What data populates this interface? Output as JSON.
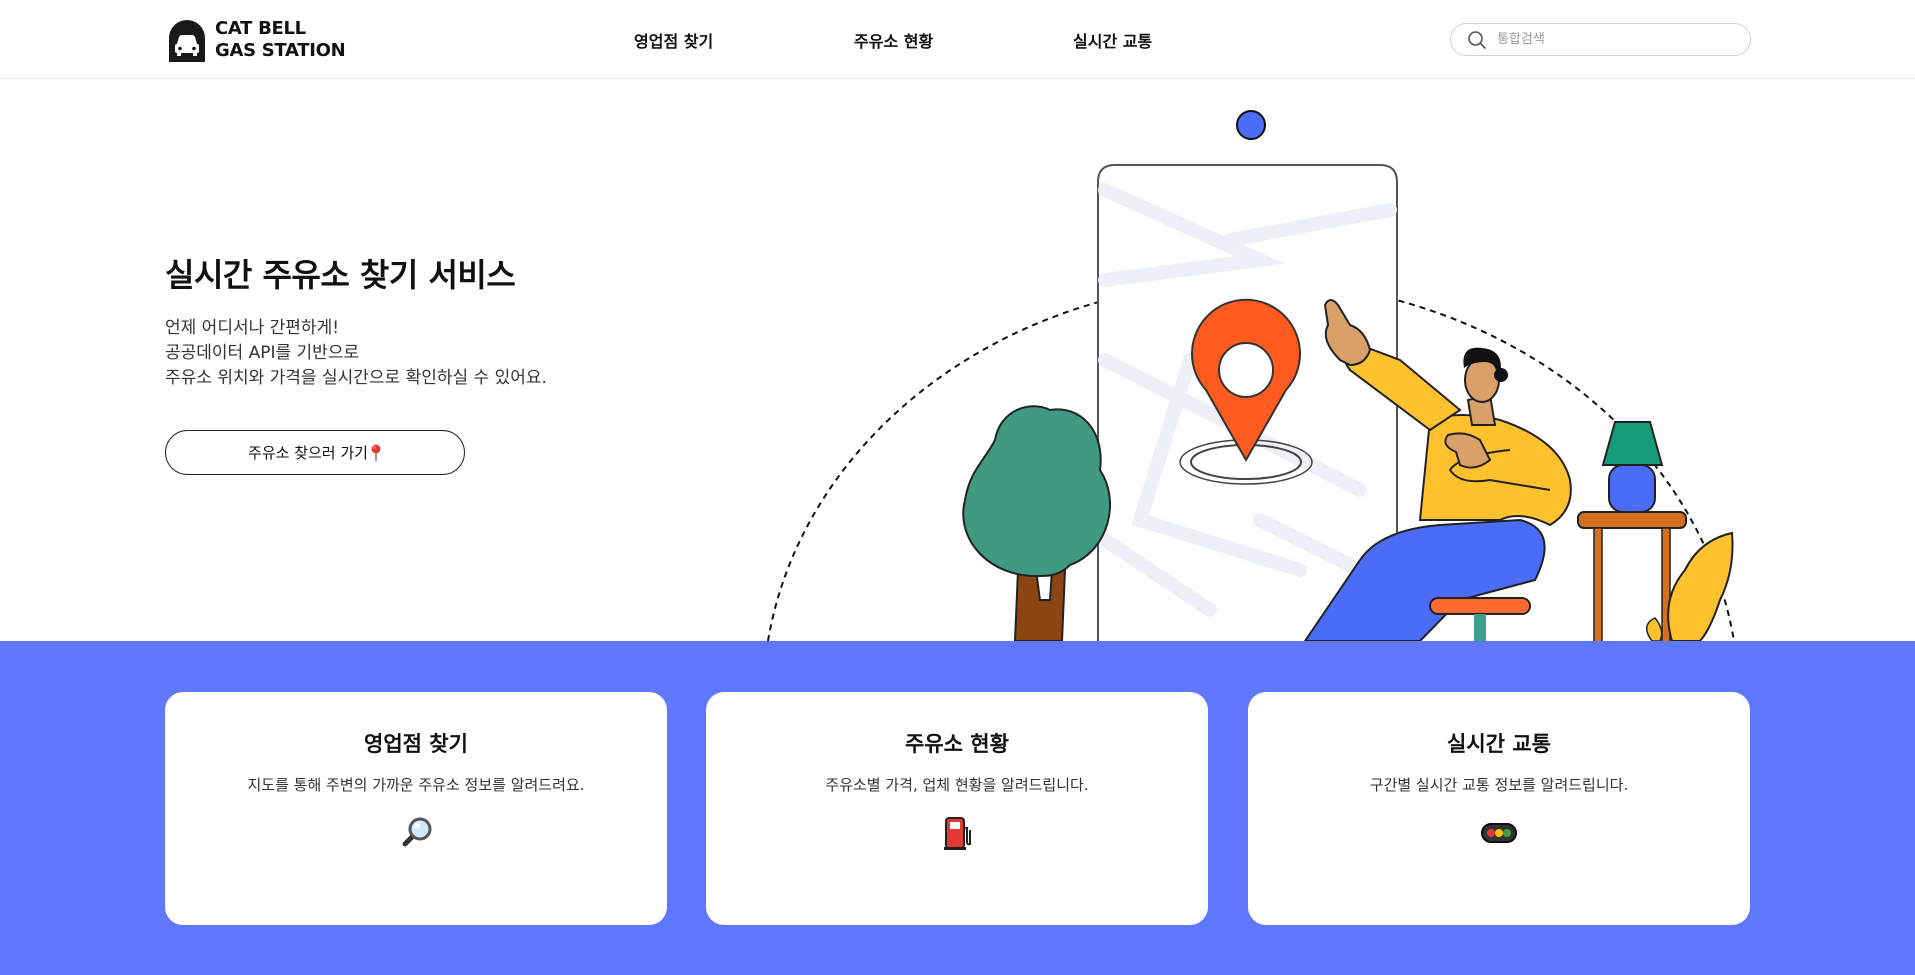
{
  "header": {
    "logo_line1": "CAT BELL",
    "logo_line2": "GAS STATION",
    "nav": [
      {
        "label": "영업점 찾기"
      },
      {
        "label": "주유소 현황"
      },
      {
        "label": "실시간 교통"
      }
    ],
    "search_placeholder": "통합검색",
    "search_icon": "search-icon"
  },
  "hero": {
    "title": "실시간 주유소 찾기 서비스",
    "desc_lines": [
      "언제 어디서나 간편하게!",
      "공공데이터 API를 기반으로",
      "주유소 위치와 가격을 실시간으로 확인하실 수 있어요."
    ],
    "cta_label": "주유소 찾으러 가기",
    "cta_icon": "pin-icon"
  },
  "cards": [
    {
      "title": "영업점 찾기",
      "desc": "지도를 통해 주변의 가까운 주유소 정보를 알려드려요.",
      "icon": "magnifier-icon"
    },
    {
      "title": "주유소 현황",
      "desc": "주유소별 가격, 업체 현황을 알려드립니다.",
      "icon": "fuel-pump-icon"
    },
    {
      "title": "실시간 교통",
      "desc": "구간별 실시간 교통 정보를 알려드립니다.",
      "icon": "traffic-light-icon"
    }
  ],
  "colors": {
    "accent_blue": "#6077ff",
    "pin_orange": "#ff5a1f",
    "shirt_yellow": "#ffc12e",
    "pants_blue": "#4a6cf7",
    "tree_green": "#409a80"
  }
}
